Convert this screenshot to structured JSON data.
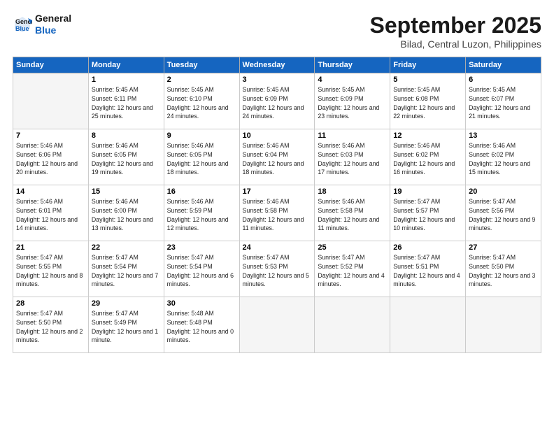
{
  "header": {
    "logo_line1": "General",
    "logo_line2": "Blue",
    "month": "September 2025",
    "location": "Bilad, Central Luzon, Philippines"
  },
  "weekdays": [
    "Sunday",
    "Monday",
    "Tuesday",
    "Wednesday",
    "Thursday",
    "Friday",
    "Saturday"
  ],
  "weeks": [
    [
      {
        "day": "",
        "sunrise": "",
        "sunset": "",
        "daylight": ""
      },
      {
        "day": "1",
        "sunrise": "Sunrise: 5:45 AM",
        "sunset": "Sunset: 6:11 PM",
        "daylight": "Daylight: 12 hours and 25 minutes."
      },
      {
        "day": "2",
        "sunrise": "Sunrise: 5:45 AM",
        "sunset": "Sunset: 6:10 PM",
        "daylight": "Daylight: 12 hours and 24 minutes."
      },
      {
        "day": "3",
        "sunrise": "Sunrise: 5:45 AM",
        "sunset": "Sunset: 6:09 PM",
        "daylight": "Daylight: 12 hours and 24 minutes."
      },
      {
        "day": "4",
        "sunrise": "Sunrise: 5:45 AM",
        "sunset": "Sunset: 6:09 PM",
        "daylight": "Daylight: 12 hours and 23 minutes."
      },
      {
        "day": "5",
        "sunrise": "Sunrise: 5:45 AM",
        "sunset": "Sunset: 6:08 PM",
        "daylight": "Daylight: 12 hours and 22 minutes."
      },
      {
        "day": "6",
        "sunrise": "Sunrise: 5:45 AM",
        "sunset": "Sunset: 6:07 PM",
        "daylight": "Daylight: 12 hours and 21 minutes."
      }
    ],
    [
      {
        "day": "7",
        "sunrise": "Sunrise: 5:46 AM",
        "sunset": "Sunset: 6:06 PM",
        "daylight": "Daylight: 12 hours and 20 minutes."
      },
      {
        "day": "8",
        "sunrise": "Sunrise: 5:46 AM",
        "sunset": "Sunset: 6:05 PM",
        "daylight": "Daylight: 12 hours and 19 minutes."
      },
      {
        "day": "9",
        "sunrise": "Sunrise: 5:46 AM",
        "sunset": "Sunset: 6:05 PM",
        "daylight": "Daylight: 12 hours and 18 minutes."
      },
      {
        "day": "10",
        "sunrise": "Sunrise: 5:46 AM",
        "sunset": "Sunset: 6:04 PM",
        "daylight": "Daylight: 12 hours and 18 minutes."
      },
      {
        "day": "11",
        "sunrise": "Sunrise: 5:46 AM",
        "sunset": "Sunset: 6:03 PM",
        "daylight": "Daylight: 12 hours and 17 minutes."
      },
      {
        "day": "12",
        "sunrise": "Sunrise: 5:46 AM",
        "sunset": "Sunset: 6:02 PM",
        "daylight": "Daylight: 12 hours and 16 minutes."
      },
      {
        "day": "13",
        "sunrise": "Sunrise: 5:46 AM",
        "sunset": "Sunset: 6:02 PM",
        "daylight": "Daylight: 12 hours and 15 minutes."
      }
    ],
    [
      {
        "day": "14",
        "sunrise": "Sunrise: 5:46 AM",
        "sunset": "Sunset: 6:01 PM",
        "daylight": "Daylight: 12 hours and 14 minutes."
      },
      {
        "day": "15",
        "sunrise": "Sunrise: 5:46 AM",
        "sunset": "Sunset: 6:00 PM",
        "daylight": "Daylight: 12 hours and 13 minutes."
      },
      {
        "day": "16",
        "sunrise": "Sunrise: 5:46 AM",
        "sunset": "Sunset: 5:59 PM",
        "daylight": "Daylight: 12 hours and 12 minutes."
      },
      {
        "day": "17",
        "sunrise": "Sunrise: 5:46 AM",
        "sunset": "Sunset: 5:58 PM",
        "daylight": "Daylight: 12 hours and 11 minutes."
      },
      {
        "day": "18",
        "sunrise": "Sunrise: 5:46 AM",
        "sunset": "Sunset: 5:58 PM",
        "daylight": "Daylight: 12 hours and 11 minutes."
      },
      {
        "day": "19",
        "sunrise": "Sunrise: 5:47 AM",
        "sunset": "Sunset: 5:57 PM",
        "daylight": "Daylight: 12 hours and 10 minutes."
      },
      {
        "day": "20",
        "sunrise": "Sunrise: 5:47 AM",
        "sunset": "Sunset: 5:56 PM",
        "daylight": "Daylight: 12 hours and 9 minutes."
      }
    ],
    [
      {
        "day": "21",
        "sunrise": "Sunrise: 5:47 AM",
        "sunset": "Sunset: 5:55 PM",
        "daylight": "Daylight: 12 hours and 8 minutes."
      },
      {
        "day": "22",
        "sunrise": "Sunrise: 5:47 AM",
        "sunset": "Sunset: 5:54 PM",
        "daylight": "Daylight: 12 hours and 7 minutes."
      },
      {
        "day": "23",
        "sunrise": "Sunrise: 5:47 AM",
        "sunset": "Sunset: 5:54 PM",
        "daylight": "Daylight: 12 hours and 6 minutes."
      },
      {
        "day": "24",
        "sunrise": "Sunrise: 5:47 AM",
        "sunset": "Sunset: 5:53 PM",
        "daylight": "Daylight: 12 hours and 5 minutes."
      },
      {
        "day": "25",
        "sunrise": "Sunrise: 5:47 AM",
        "sunset": "Sunset: 5:52 PM",
        "daylight": "Daylight: 12 hours and 4 minutes."
      },
      {
        "day": "26",
        "sunrise": "Sunrise: 5:47 AM",
        "sunset": "Sunset: 5:51 PM",
        "daylight": "Daylight: 12 hours and 4 minutes."
      },
      {
        "day": "27",
        "sunrise": "Sunrise: 5:47 AM",
        "sunset": "Sunset: 5:50 PM",
        "daylight": "Daylight: 12 hours and 3 minutes."
      }
    ],
    [
      {
        "day": "28",
        "sunrise": "Sunrise: 5:47 AM",
        "sunset": "Sunset: 5:50 PM",
        "daylight": "Daylight: 12 hours and 2 minutes."
      },
      {
        "day": "29",
        "sunrise": "Sunrise: 5:47 AM",
        "sunset": "Sunset: 5:49 PM",
        "daylight": "Daylight: 12 hours and 1 minute."
      },
      {
        "day": "30",
        "sunrise": "Sunrise: 5:48 AM",
        "sunset": "Sunset: 5:48 PM",
        "daylight": "Daylight: 12 hours and 0 minutes."
      },
      {
        "day": "",
        "sunrise": "",
        "sunset": "",
        "daylight": ""
      },
      {
        "day": "",
        "sunrise": "",
        "sunset": "",
        "daylight": ""
      },
      {
        "day": "",
        "sunrise": "",
        "sunset": "",
        "daylight": ""
      },
      {
        "day": "",
        "sunrise": "",
        "sunset": "",
        "daylight": ""
      }
    ]
  ]
}
